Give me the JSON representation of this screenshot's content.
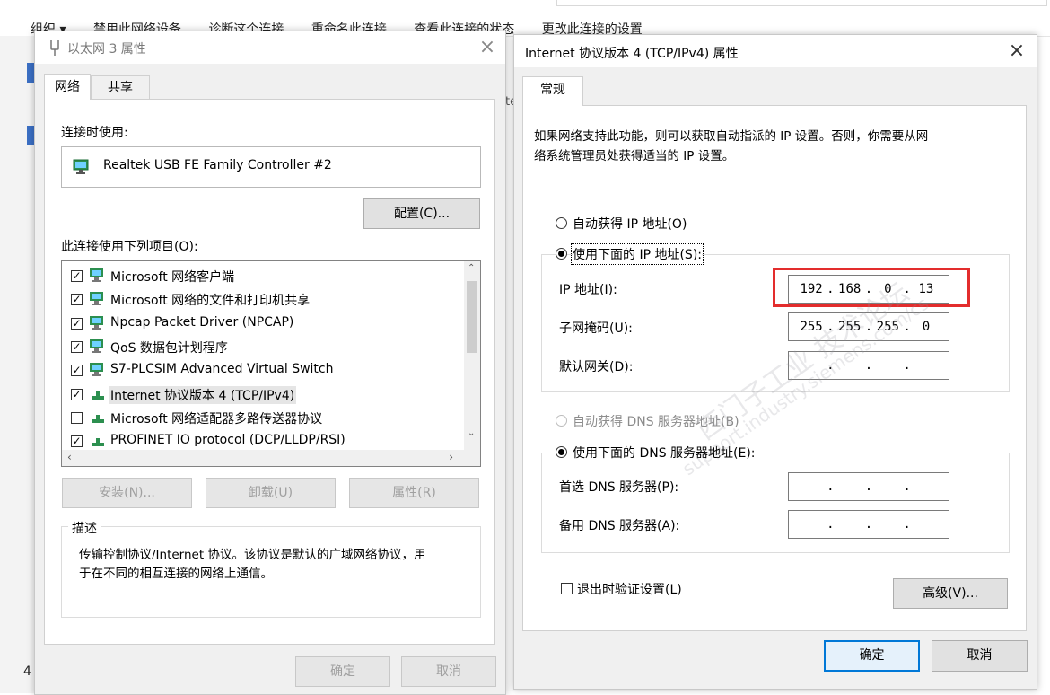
{
  "background": {
    "toolbar_items": [
      "组织 ▾",
      "禁用此网络设备",
      "诊断这个连接",
      "重命名此连接",
      "查看此连接的状态",
      "更改此连接的设置"
    ],
    "partial_text_ste": "te",
    "partial_text_four": "4"
  },
  "left_dialog": {
    "title": "以太网 3 属性",
    "tabs": [
      "网络",
      "共享"
    ],
    "connect_using_label": "连接时使用:",
    "adapter_name": "Realtek USB FE Family Controller #2",
    "configure_button": "配置(C)...",
    "items_label": "此连接使用下列项目(O):",
    "items": [
      {
        "label": "Microsoft 网络客户端",
        "checked": true
      },
      {
        "label": "Microsoft 网络的文件和打印机共享",
        "checked": true
      },
      {
        "label": "Npcap Packet Driver (NPCAP)",
        "checked": true
      },
      {
        "label": "QoS 数据包计划程序",
        "checked": true
      },
      {
        "label": "S7-PLCSIM Advanced Virtual Switch",
        "checked": true
      },
      {
        "label": "Internet 协议版本 4 (TCP/IPv4)",
        "checked": true
      },
      {
        "label": "Microsoft 网络适配器多路传送器协议",
        "checked": false
      },
      {
        "label": "PROFINET IO protocol (DCP/LLDP/RSI)",
        "checked": true
      }
    ],
    "install_button": "安装(N)...",
    "uninstall_button": "卸载(U)",
    "properties_button": "属性(R)",
    "description_label": "描述",
    "description_line1": "传输控制协议/Internet 协议。该协议是默认的广域网络协议，用",
    "description_line2": "于在不同的相互连接的网络上通信。",
    "ok_button": "确定",
    "cancel_button": "取消"
  },
  "right_dialog": {
    "title": "Internet 协议版本 4 (TCP/IPv4) 属性",
    "tab": "常规",
    "intro_line1": "如果网络支持此功能，则可以获取自动指派的 IP 设置。否则，你需要从网",
    "intro_line2": "络系统管理员处获得适当的 IP 设置。",
    "auto_ip_label": "自动获得 IP 地址(O)",
    "manual_ip_label": "使用下面的 IP 地址(S):",
    "ip_address_label": "IP 地址(I):",
    "ip_address": [
      "192",
      "168",
      "0",
      "13"
    ],
    "subnet_label": "子网掩码(U):",
    "subnet_mask": [
      "255",
      "255",
      "255",
      "0"
    ],
    "gateway_label": "默认网关(D):",
    "gateway": [
      "",
      "",
      "",
      ""
    ],
    "auto_dns_label": "自动获得 DNS 服务器地址(B)",
    "manual_dns_label": "使用下面的 DNS 服务器地址(E):",
    "preferred_dns_label": "首选 DNS 服务器(P):",
    "preferred_dns": [
      "",
      "",
      "",
      ""
    ],
    "alternate_dns_label": "备用 DNS 服务器(A):",
    "alternate_dns": [
      "",
      "",
      "",
      ""
    ],
    "validate_label": "退出时验证设置(L)",
    "advanced_button": "高级(V)...",
    "ok_button": "确定",
    "cancel_button": "取消"
  },
  "watermark": {
    "line1": "西门子工业 技术论坛",
    "line2": "support.industry.siemens.com/cs"
  },
  "colors": {
    "highlight_box": "#e32d2d",
    "accent": "#0078d7",
    "dialog_bg": "#f0f0f0"
  }
}
